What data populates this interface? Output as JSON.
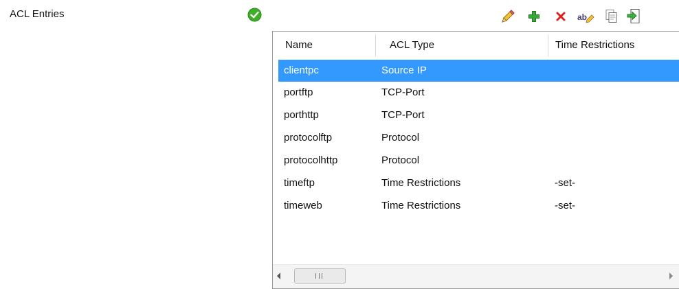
{
  "section": {
    "label": "ACL Entries"
  },
  "status": {
    "icon": "check-circle-icon",
    "color": "#3fae29"
  },
  "toolbar": {
    "buttons": [
      {
        "name": "edit",
        "icon": "pencil-icon"
      },
      {
        "name": "add",
        "icon": "plus-icon",
        "color": "#2e9e2e"
      },
      {
        "name": "delete",
        "icon": "close-x-icon",
        "color": "#e02020"
      },
      {
        "name": "rename",
        "icon": "rename-ab-icon"
      },
      {
        "name": "copy",
        "icon": "copy-document-icon"
      },
      {
        "name": "import",
        "icon": "import-icon"
      }
    ]
  },
  "table": {
    "columns": [
      "Name",
      "ACL Type",
      "Time Restrictions"
    ],
    "rows": [
      {
        "name": "clientpc",
        "type": "Source IP",
        "time": "",
        "selected": true
      },
      {
        "name": "portftp",
        "type": "TCP-Port",
        "time": ""
      },
      {
        "name": "porthttp",
        "type": "TCP-Port",
        "time": ""
      },
      {
        "name": "protocolftp",
        "type": "Protocol",
        "time": ""
      },
      {
        "name": "protocolhttp",
        "type": "Protocol",
        "time": ""
      },
      {
        "name": "timeftp",
        "type": "Time Restrictions",
        "time": "-set-"
      },
      {
        "name": "timeweb",
        "type": "Time Restrictions",
        "time": "-set-"
      }
    ],
    "selection_color": "#3399ff"
  }
}
